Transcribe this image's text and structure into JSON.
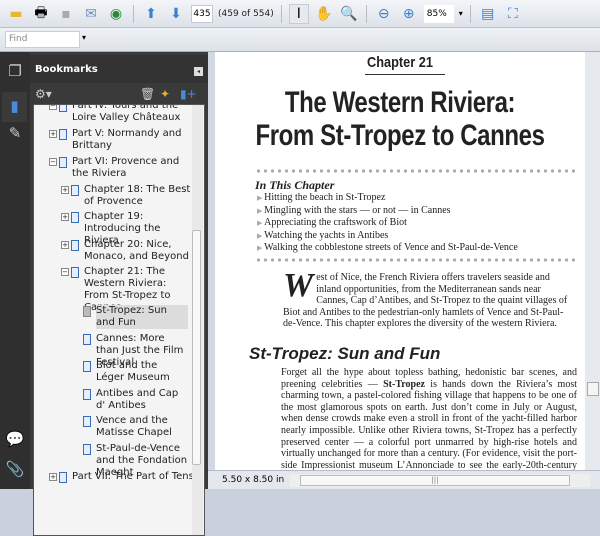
{
  "toolbar": {
    "page_number": "435",
    "page_count": "(459 of 554)",
    "zoom": "85%"
  },
  "find": {
    "placeholder": "Find"
  },
  "bookmarks": {
    "title": "Bookmarks",
    "items": [
      "Part IV: Tours and the Loire Valley Châteaux",
      "Part V: Normandy and Brittany",
      "Part VI: Provence and the Riviera",
      "Chapter 18: The Best of Provence",
      "Chapter 19: Introducing the Riviera",
      "Chapter 20: Nice, Monaco, and Beyond",
      "Chapter 21: The Western Riviera: From St-Tropez to Cannes",
      "St-Tropez: Sun and Fun",
      "Cannes: More than Just the Film Festival",
      "Biot and the Léger Museum",
      "Antibes and Cap d' Antibes",
      "Vence and the Matisse Chapel",
      "St-Paul-de-Vence and the Fondation Maeght",
      "Part VII: The Part of Tens"
    ]
  },
  "page": {
    "chapter": "Chapter 21",
    "title_line1": "The Western Riviera:",
    "title_line2": "From St-Tropez to Cannes",
    "in_this_chapter": "In This Chapter",
    "bullets": [
      "Hitting the beach in St-Tropez",
      "Mingling with the stars — or not — in Cannes",
      "Appreciating the craftswork of Biot",
      "Watching the yachts in Antibes",
      "Walking the cobblestone streets of Vence and St-Paul-de-Vence"
    ],
    "dropcap": "W",
    "intro": "est of Nice, the French Riviera offers travelers seaside and inland opportunities, from the Mediterranean sands near Cannes, Cap d’Antibes, and St-Tropez to the quaint villages of Biot and Antibes to the pedestrian-only hamlets of Vence and St-Paul-de-Vence. This chapter explores the diversity of the western Riviera.",
    "section_heading": "St-Tropez: Sun and Fun",
    "body_pre": "Forget all the hype about topless bathing, hedonistic bar scenes, and preening celebrities — ",
    "body_bold": "St-Tropez",
    "body_post": " is hands down the Riviera’s most charming town, a pastel-colored fishing village that happens to be one of the most glamorous spots on earth. Just don’t come in July or August, when dense crowds make even a stroll in front of the yacht-filled harbor nearly impossible. Unlike other Riviera towns, St-Tropez has a perfectly preserved center — a colorful port unmarred by high-rise hotels and virtually unchanged for more than a century. (For evidence, visit the port-side Impressionist museum L’Annonciade to see the early-20th-century images of St-Tropez.) Bustling cafes crowd the old port, and behind them, the winding village streets beckon with exclusive boutiques and"
  },
  "status": {
    "page_size": "5.50 x 8.50 in"
  }
}
